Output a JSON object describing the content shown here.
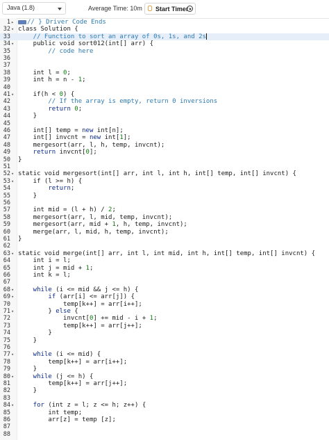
{
  "toolbar": {
    "language": "Java (1.8)",
    "average_time": "Average Time: 10m",
    "start_timer": "Start Timer"
  },
  "editor": {
    "active_line": "33",
    "lines": [
      {
        "n": "1",
        "fold": "▸",
        "segs": [
          {
            "t": "// } Driver Code Ends",
            "c": "cm"
          }
        ],
        "marker": true
      },
      {
        "n": "32",
        "fold": "▾",
        "segs": [
          {
            "t": "class Solution {",
            "c": ""
          }
        ]
      },
      {
        "n": "33",
        "fold": "",
        "segs": [
          {
            "t": "    // Function to sort an array of 0s, 1s, and 2s",
            "c": "cm"
          }
        ],
        "caret": true
      },
      {
        "n": "34",
        "fold": "▾",
        "segs": [
          {
            "t": "    public void sort012(int[] arr) {",
            "c": ""
          }
        ]
      },
      {
        "n": "35",
        "fold": "",
        "segs": [
          {
            "t": "        // code here",
            "c": "cm"
          }
        ]
      },
      {
        "n": "36",
        "fold": "",
        "segs": []
      },
      {
        "n": "37",
        "fold": "",
        "segs": []
      },
      {
        "n": "38",
        "fold": "",
        "segs": [
          {
            "t": "    int l = ",
            "c": ""
          },
          {
            "t": "0",
            "c": "num"
          },
          {
            "t": ";",
            "c": ""
          }
        ]
      },
      {
        "n": "39",
        "fold": "",
        "segs": [
          {
            "t": "    int h = n - ",
            "c": ""
          },
          {
            "t": "1",
            "c": "num"
          },
          {
            "t": ";",
            "c": ""
          }
        ]
      },
      {
        "n": "40",
        "fold": "",
        "segs": []
      },
      {
        "n": "41",
        "fold": "▾",
        "segs": [
          {
            "t": "    if(h < ",
            "c": ""
          },
          {
            "t": "0",
            "c": "num"
          },
          {
            "t": ") {",
            "c": ""
          }
        ]
      },
      {
        "n": "42",
        "fold": "",
        "segs": [
          {
            "t": "        // If the array is empty, return 0 inversions",
            "c": "cm"
          }
        ]
      },
      {
        "n": "43",
        "fold": "",
        "segs": [
          {
            "t": "        return ",
            "c": "kw"
          },
          {
            "t": "0",
            "c": "num"
          },
          {
            "t": ";",
            "c": ""
          }
        ]
      },
      {
        "n": "44",
        "fold": "",
        "segs": [
          {
            "t": "    }",
            "c": ""
          }
        ]
      },
      {
        "n": "45",
        "fold": "",
        "segs": []
      },
      {
        "n": "46",
        "fold": "",
        "segs": [
          {
            "t": "    int[] temp = ",
            "c": ""
          },
          {
            "t": "new",
            "c": "kw"
          },
          {
            "t": " int[n];",
            "c": ""
          }
        ]
      },
      {
        "n": "47",
        "fold": "",
        "segs": [
          {
            "t": "    int[] invcnt = ",
            "c": ""
          },
          {
            "t": "new",
            "c": "kw"
          },
          {
            "t": " int[",
            "c": ""
          },
          {
            "t": "1",
            "c": "num"
          },
          {
            "t": "];",
            "c": ""
          }
        ]
      },
      {
        "n": "48",
        "fold": "",
        "segs": [
          {
            "t": "    mergesort(arr, l, h, temp, invcnt);",
            "c": ""
          }
        ]
      },
      {
        "n": "49",
        "fold": "",
        "segs": [
          {
            "t": "    return",
            "c": "kw"
          },
          {
            "t": " invcnt[",
            "c": ""
          },
          {
            "t": "0",
            "c": "num"
          },
          {
            "t": "];",
            "c": ""
          }
        ]
      },
      {
        "n": "50",
        "fold": "",
        "segs": [
          {
            "t": "}",
            "c": ""
          }
        ]
      },
      {
        "n": "51",
        "fold": "",
        "segs": []
      },
      {
        "n": "52",
        "fold": "▾",
        "segs": [
          {
            "t": "static void mergesort(int[] arr, int l, int h, int[] temp, int[] invcnt) {",
            "c": ""
          }
        ]
      },
      {
        "n": "53",
        "fold": "▾",
        "segs": [
          {
            "t": "    if (l >= h) {",
            "c": ""
          }
        ]
      },
      {
        "n": "54",
        "fold": "",
        "segs": [
          {
            "t": "        return",
            "c": "kw"
          },
          {
            "t": ";",
            "c": ""
          }
        ]
      },
      {
        "n": "55",
        "fold": "",
        "segs": [
          {
            "t": "    }",
            "c": ""
          }
        ]
      },
      {
        "n": "56",
        "fold": "",
        "segs": []
      },
      {
        "n": "57",
        "fold": "",
        "segs": [
          {
            "t": "    int mid = (l + h) / ",
            "c": ""
          },
          {
            "t": "2",
            "c": "num"
          },
          {
            "t": ";",
            "c": ""
          }
        ]
      },
      {
        "n": "58",
        "fold": "",
        "segs": [
          {
            "t": "    mergesort(arr, l, mid, temp, invcnt);",
            "c": ""
          }
        ]
      },
      {
        "n": "59",
        "fold": "",
        "segs": [
          {
            "t": "    mergesort(arr, mid + ",
            "c": ""
          },
          {
            "t": "1",
            "c": "num"
          },
          {
            "t": ", h, temp, invcnt);",
            "c": ""
          }
        ]
      },
      {
        "n": "60",
        "fold": "",
        "segs": [
          {
            "t": "    merge(arr, l, mid, h, temp, invcnt);",
            "c": ""
          }
        ]
      },
      {
        "n": "61",
        "fold": "",
        "segs": [
          {
            "t": "}",
            "c": ""
          }
        ]
      },
      {
        "n": "62",
        "fold": "",
        "segs": []
      },
      {
        "n": "63",
        "fold": "▾",
        "segs": [
          {
            "t": "static void merge(int[] arr, int l, int mid, int h, int[] temp, int[] invcnt) {",
            "c": ""
          }
        ]
      },
      {
        "n": "64",
        "fold": "",
        "segs": [
          {
            "t": "    int i = l;",
            "c": ""
          }
        ]
      },
      {
        "n": "65",
        "fold": "",
        "segs": [
          {
            "t": "    int j = mid + ",
            "c": ""
          },
          {
            "t": "1",
            "c": "num"
          },
          {
            "t": ";",
            "c": ""
          }
        ]
      },
      {
        "n": "66",
        "fold": "",
        "segs": [
          {
            "t": "    int k = l;",
            "c": ""
          }
        ]
      },
      {
        "n": "67",
        "fold": "",
        "segs": []
      },
      {
        "n": "68",
        "fold": "▾",
        "segs": [
          {
            "t": "    while",
            "c": "kw"
          },
          {
            "t": " (i <= mid && j <= h) {",
            "c": ""
          }
        ]
      },
      {
        "n": "69",
        "fold": "▾",
        "segs": [
          {
            "t": "        if",
            "c": "kw"
          },
          {
            "t": " (arr[i] <= arr[j]) {",
            "c": ""
          }
        ]
      },
      {
        "n": "70",
        "fold": "",
        "segs": [
          {
            "t": "            temp[k++] = arr[i++];",
            "c": ""
          }
        ]
      },
      {
        "n": "71",
        "fold": "▾",
        "segs": [
          {
            "t": "        } ",
            "c": ""
          },
          {
            "t": "else",
            "c": "kw"
          },
          {
            "t": " {",
            "c": ""
          }
        ]
      },
      {
        "n": "72",
        "fold": "",
        "segs": [
          {
            "t": "            invcnt[",
            "c": ""
          },
          {
            "t": "0",
            "c": "num"
          },
          {
            "t": "] += mid - i + ",
            "c": ""
          },
          {
            "t": "1",
            "c": "num"
          },
          {
            "t": ";",
            "c": ""
          }
        ]
      },
      {
        "n": "73",
        "fold": "",
        "segs": [
          {
            "t": "            temp[k++] = arr[j++];",
            "c": ""
          }
        ]
      },
      {
        "n": "74",
        "fold": "",
        "segs": [
          {
            "t": "        }",
            "c": ""
          }
        ]
      },
      {
        "n": "75",
        "fold": "",
        "segs": [
          {
            "t": "    }",
            "c": ""
          }
        ]
      },
      {
        "n": "76",
        "fold": "",
        "segs": []
      },
      {
        "n": "77",
        "fold": "▾",
        "segs": [
          {
            "t": "    while",
            "c": "kw"
          },
          {
            "t": " (i <= mid) {",
            "c": ""
          }
        ]
      },
      {
        "n": "78",
        "fold": "",
        "segs": [
          {
            "t": "        temp[k++] = arr[i++];",
            "c": ""
          }
        ]
      },
      {
        "n": "79",
        "fold": "",
        "segs": [
          {
            "t": "    }",
            "c": ""
          }
        ]
      },
      {
        "n": "80",
        "fold": "▾",
        "segs": [
          {
            "t": "    while",
            "c": "kw"
          },
          {
            "t": " (j <= h) {",
            "c": ""
          }
        ]
      },
      {
        "n": "81",
        "fold": "",
        "segs": [
          {
            "t": "        temp[k++] = arr[j++];",
            "c": ""
          }
        ]
      },
      {
        "n": "82",
        "fold": "",
        "segs": [
          {
            "t": "    }",
            "c": ""
          }
        ]
      },
      {
        "n": "83",
        "fold": "",
        "segs": []
      },
      {
        "n": "84",
        "fold": "▾",
        "segs": [
          {
            "t": "    for",
            "c": "kw"
          },
          {
            "t": " (int z = l; z <= h; z++) {",
            "c": ""
          }
        ]
      },
      {
        "n": "85",
        "fold": "",
        "segs": [
          {
            "t": "        int temp;",
            "c": ""
          }
        ]
      },
      {
        "n": "86",
        "fold": "",
        "segs": [
          {
            "t": "        arr[z] = temp [z];",
            "c": ""
          }
        ]
      },
      {
        "n": "87",
        "fold": "",
        "segs": []
      },
      {
        "n": "88",
        "fold": "",
        "segs": []
      }
    ]
  },
  "colors": {
    "keyword": "#0b2a8c",
    "comment": "#2e7bb3",
    "number": "#0d7a0d",
    "active_line_bg": "#e6eefa",
    "fold_marker": "#5f7fb8"
  }
}
